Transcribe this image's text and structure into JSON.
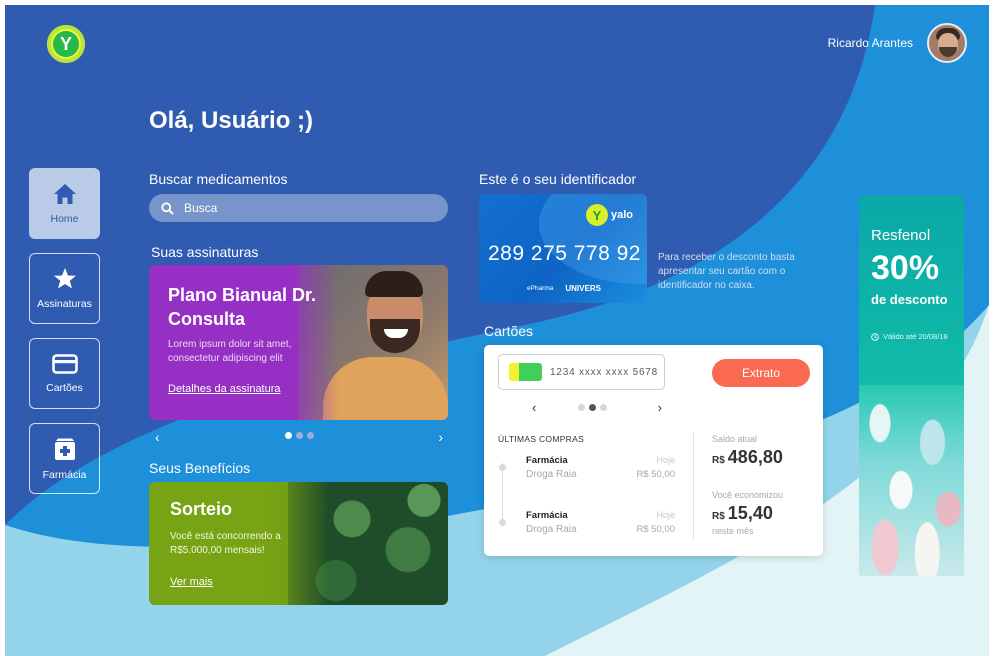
{
  "colors": {
    "background_blue": "#2f5bb0",
    "light_blue_wave": "#94d4ea",
    "subscription_purple": "#9630c4",
    "benefit_green": "#77a314",
    "extrato_button": "#fa6a50",
    "promo_teal": "#13c0a8"
  },
  "header": {
    "logo_letter": "Y",
    "user_name": "Ricardo Arantes",
    "avatar_icon": "user-avatar"
  },
  "greeting": "Olá, Usuário ;)",
  "sidebar": {
    "items": [
      {
        "label": "Home",
        "icon": "home-icon",
        "active": true
      },
      {
        "label": "Assinaturas",
        "icon": "star-icon",
        "active": false
      },
      {
        "label": "Cartões",
        "icon": "credit-card-icon",
        "active": false
      },
      {
        "label": "Farmácia",
        "icon": "pharmacy-icon",
        "active": false
      }
    ]
  },
  "search": {
    "title": "Buscar medicamentos",
    "placeholder": "Busca"
  },
  "subscriptions": {
    "title": "Suas assinaturas",
    "card_title": "Plano Bianual Dr. Consulta",
    "card_desc": "Lorem ipsum dolor sit amet, consectetur adipiscing elit",
    "card_link": "Detalhes da assinatura",
    "prev": "‹",
    "next": "›"
  },
  "benefits": {
    "title": "Seus Benefícios",
    "card_title": "Sorteio",
    "card_desc": "Você está concorrendo  a R$5.000,00 mensais!",
    "card_link": "Ver mais"
  },
  "identifier": {
    "title": "Este é o seu identificador",
    "brand": "yalo",
    "number": "289 275 778 92",
    "partner_1": "ePharma",
    "partner_2": "UNIVERS",
    "info": "Para receber o desconto basta apresentar seu cartão com o identificador no caixa."
  },
  "cards": {
    "title": "Cartões",
    "card_number": "1234  xxxx  xxxx  5678",
    "extrato_label": "Extrato",
    "prev": "‹",
    "next": "›",
    "purchases_title": "ÚLTIMAS COMPRAS",
    "purchases": [
      {
        "category": "Farmácia",
        "store": "Droga Raia",
        "when": "Hoje",
        "amount": "R$ 50,00"
      },
      {
        "category": "Farmácia",
        "store": "Droga Raia",
        "when": "Hoje",
        "amount": "R$ 50,00"
      }
    ],
    "balance_label": "Saldo atual",
    "balance_currency": "R$",
    "balance_value": "486,80",
    "saved_label": "Você economizou",
    "saved_currency": "R$",
    "saved_value": "15,40",
    "saved_period": "neste mês"
  },
  "promo": {
    "product": "Resfenol",
    "discount": "30%",
    "discount_label": "de desconto",
    "validity": "Válido até 20/08/18",
    "clock_icon": "clock-icon"
  }
}
